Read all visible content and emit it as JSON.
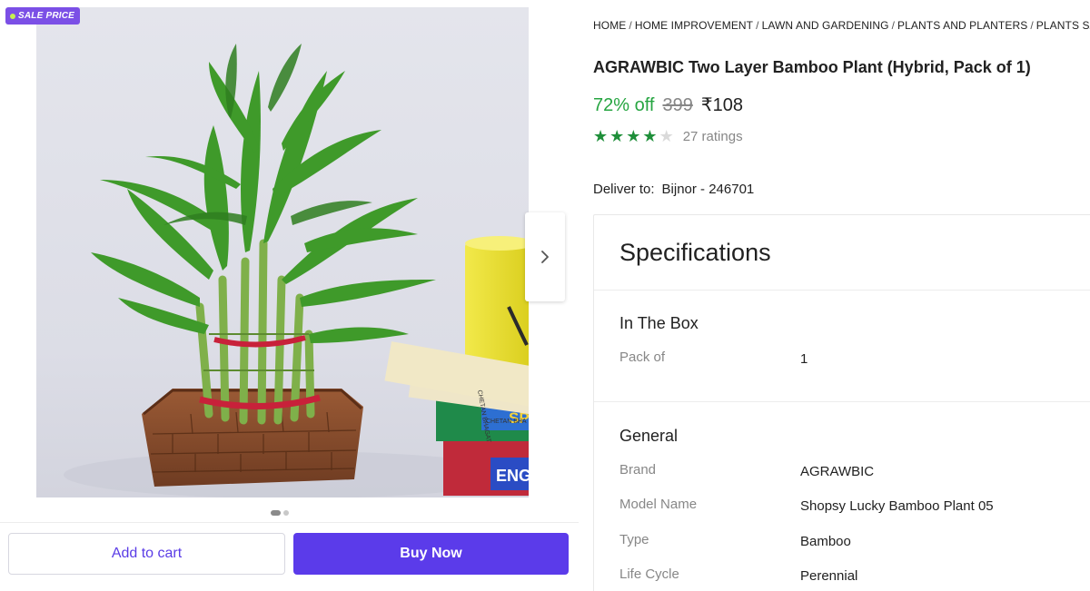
{
  "gallery": {
    "sale_badge": "SALE PRICE",
    "image_alt": "Two layer lucky bamboo plant in brick pot",
    "dots_count": 2,
    "active_dot": 0,
    "book_labels": [
      "CHETAN BHA",
      "CHETAN BHAGAT",
      "SP",
      "ENG"
    ]
  },
  "actions": {
    "add_to_cart": "Add to cart",
    "buy_now": "Buy Now"
  },
  "breadcrumb": [
    "HOME",
    "HOME IMPROVEMENT",
    "LAWN AND GARDENING",
    "PLANTS AND PLANTERS",
    "PLANTS SAPLINGS"
  ],
  "product": {
    "title": "AGRAWBIC Two Layer Bamboo Plant (Hybrid, Pack of 1)",
    "discount": "72% off",
    "mrp": "399",
    "price": "₹108",
    "rating_value": 4,
    "rating_max": 5,
    "ratings_count": "27 ratings"
  },
  "delivery": {
    "label": "Deliver to:",
    "location": "Bijnor - 246701"
  },
  "specifications": {
    "heading": "Specifications",
    "groups": [
      {
        "title": "In The Box",
        "rows": [
          {
            "key": "Pack of",
            "value": "1"
          }
        ]
      },
      {
        "title": "General",
        "rows": [
          {
            "key": "Brand",
            "value": "AGRAWBIC"
          },
          {
            "key": "Model Name",
            "value": "Shopsy Lucky Bamboo Plant 05"
          },
          {
            "key": "Type",
            "value": "Bamboo"
          },
          {
            "key": "Life Cycle",
            "value": "Perennial"
          }
        ]
      }
    ]
  },
  "colors": {
    "primary": "#5b3bea",
    "discount": "#26a541",
    "star": "#1f8f3a",
    "badge": "#7b4fe6"
  }
}
